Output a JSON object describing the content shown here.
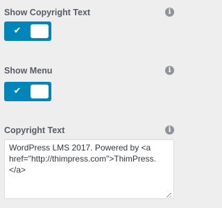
{
  "settings": {
    "show_copyright_text": {
      "label": "Show Copyright Text",
      "enabled": true,
      "info_icon": "info-icon"
    },
    "show_menu": {
      "label": "Show Menu",
      "enabled": true,
      "info_icon": "info-icon"
    },
    "copyright_text": {
      "label": "Copyright Text",
      "value": "WordPress LMS 2017. Powered by <a href=\"http://thimpress.com\">ThimPress.</a>",
      "info_icon": "info-icon"
    }
  },
  "icons": {
    "info": "i",
    "check": "✔"
  },
  "colors": {
    "background": "#eeeeee",
    "toggle_on": "#0085ba",
    "label": "#555d66",
    "info_icon": "#8e9499"
  }
}
